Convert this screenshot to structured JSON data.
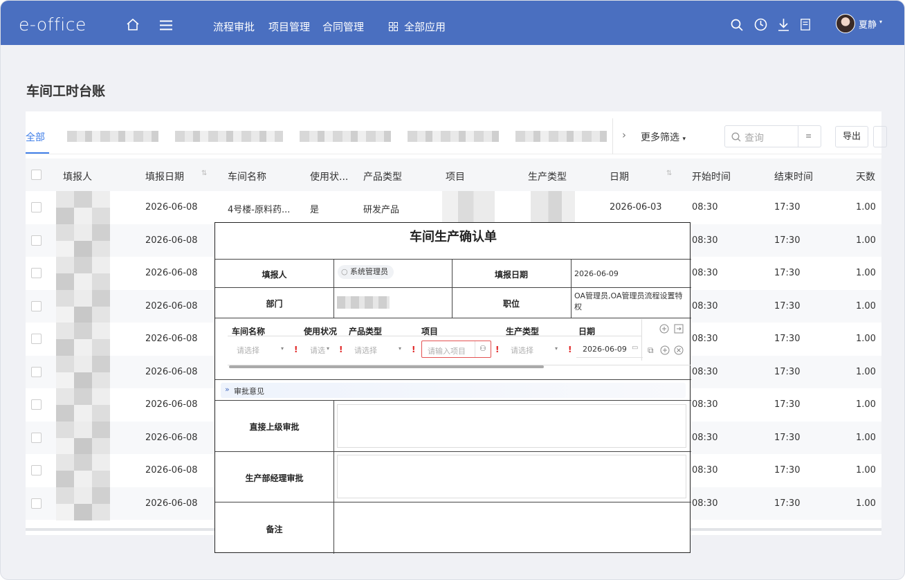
{
  "topbar": {
    "logo": "e-office",
    "nav": [
      "流程审批",
      "项目管理",
      "合同管理",
      "全部应用"
    ],
    "user_name": "夏静",
    "icons": [
      "home-icon",
      "menu-icon",
      "search-icon",
      "clock-icon",
      "download-icon",
      "document-icon"
    ]
  },
  "page": {
    "title": "车间工时台账",
    "tab_all": "全部",
    "more_filter": "更多筛选",
    "search_placeholder": "查询",
    "export": "导出"
  },
  "table": {
    "headers": [
      "填报人",
      "填报日期",
      "车间名称",
      "使用状...",
      "产品类型",
      "项目",
      "生产类型",
      "日期",
      "开始时间",
      "结束时间",
      "天数"
    ],
    "rows": [
      {
        "date": "2026-06-08",
        "workshop": "4号楼-原料药...",
        "status": "是",
        "product": "研发产品",
        "day": "2026-06-03",
        "start": "08:30",
        "end": "17:30",
        "days": "1.00"
      },
      {
        "date": "2026-06-08",
        "start": "08:30",
        "end": "17:30",
        "days": "1.00"
      },
      {
        "date": "2026-06-08",
        "start": "08:30",
        "end": "17:30",
        "days": "1.00"
      },
      {
        "date": "2026-06-08",
        "start": "08:30",
        "end": "17:30",
        "days": "1.00"
      },
      {
        "date": "2026-06-08",
        "start": "08:30",
        "end": "17:30",
        "days": "1.00"
      },
      {
        "date": "2026-06-08",
        "start": "08:30",
        "end": "17:30",
        "days": "1.00"
      },
      {
        "date": "2026-06-08",
        "start": "08:30",
        "end": "17:30",
        "days": "1.00"
      },
      {
        "date": "2026-06-08",
        "start": "08:30",
        "end": "17:30",
        "days": "1.00"
      },
      {
        "date": "2026-06-08",
        "start": "08:30",
        "end": "17:30",
        "days": "1.00"
      },
      {
        "date": "2026-06-08",
        "start": "08:30",
        "end": "17:30",
        "days": "1.00"
      }
    ]
  },
  "form": {
    "title": "车间生产确认单",
    "reporter_label": "填报人",
    "reporter_value": "系统管理员",
    "report_date_label": "填报日期",
    "report_date_value": "2026-06-09",
    "dept_label": "部门",
    "position_label": "职位",
    "position_value": "OA管理员,OA管理员流程设置特权",
    "sub_headers": [
      "车间名称",
      "使用状况",
      "产品类型",
      "项目",
      "生产类型",
      "日期"
    ],
    "select_placeholder": "请选择",
    "select_placeholder_short": "请选",
    "project_placeholder": "请输入项目",
    "date_value": "2026-06-09",
    "opinion_label": "审批意见",
    "approval_1": "直接上级审批",
    "approval_2": "生产部经理审批",
    "remark": "备注"
  }
}
